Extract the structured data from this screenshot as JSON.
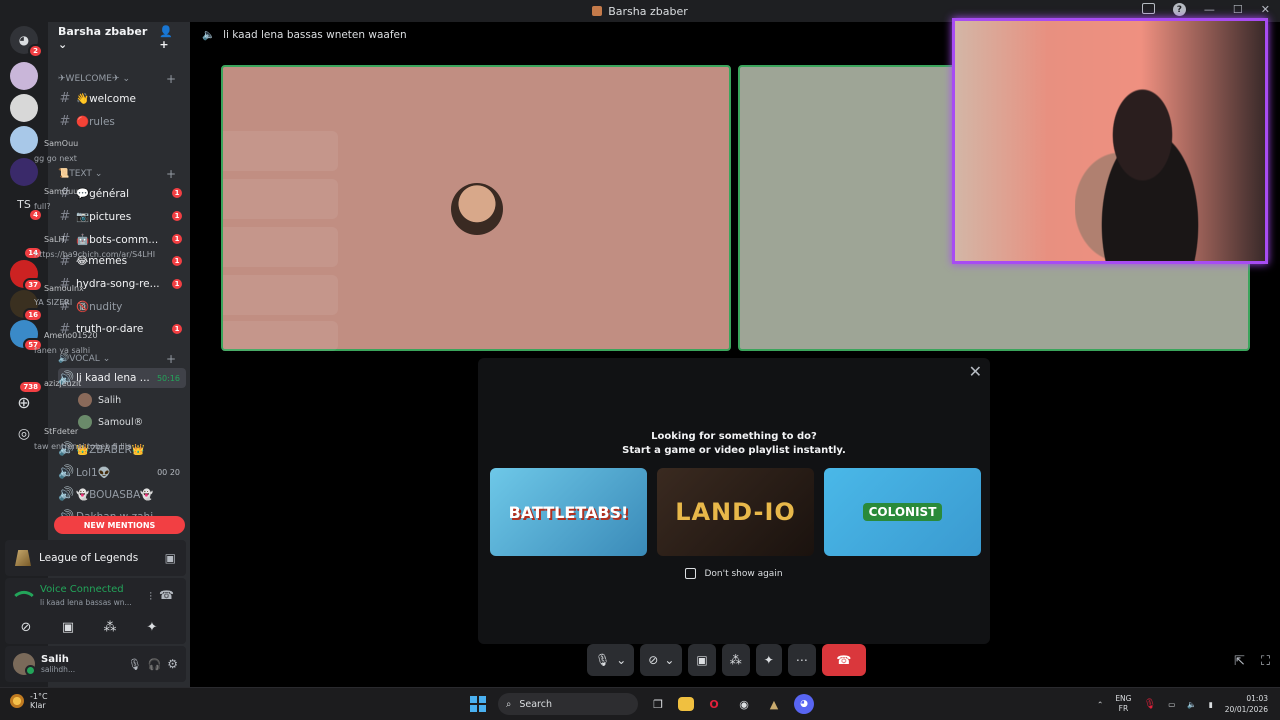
{
  "window": {
    "title": "Barsha zbaber"
  },
  "rail": {
    "home_badge": "2",
    "servers": [
      {
        "label": "",
        "badge": ""
      },
      {
        "label": "",
        "badge": ""
      },
      {
        "label": "",
        "badge": ""
      },
      {
        "label": "",
        "badge": ""
      },
      {
        "label": "TS",
        "badge": "4"
      },
      {
        "label": "",
        "badge": "14"
      },
      {
        "label": "",
        "badge": "37"
      },
      {
        "label": "",
        "badge": "16"
      },
      {
        "label": "",
        "badge": "57"
      },
      {
        "label": "",
        "badge": "738"
      }
    ]
  },
  "sidebar": {
    "server_name": "Barsha zbaber",
    "categories": {
      "welcome": "✈WELCOME✈",
      "text": "📜TEXT",
      "vocal": "🔊VOCAL"
    },
    "channels": [
      {
        "name": "👋welcome",
        "badge": ""
      },
      {
        "name": "🔴rules",
        "badge": ""
      },
      {
        "name": "💬général",
        "badge": "1"
      },
      {
        "name": "📷pictures",
        "badge": "1"
      },
      {
        "name": "🤖bots-comm...",
        "badge": "1"
      },
      {
        "name": "😂memes",
        "badge": "1"
      },
      {
        "name": "hydra-song-re...",
        "badge": "1"
      },
      {
        "name": "🔞nudity",
        "badge": ""
      },
      {
        "name": "truth-or-dare",
        "badge": "1"
      }
    ],
    "voice_channels": [
      {
        "name": "li kaad lena ...",
        "timer": "50:16"
      },
      {
        "name": "👑ZBABER👑",
        "timer": ""
      },
      {
        "name": "Lol1👽",
        "timer": "00 20"
      },
      {
        "name": "👻BOUASBA👻",
        "timer": ""
      },
      {
        "name": "Dakhan w zahi",
        "timer": ""
      }
    ],
    "voice_users": [
      "Salih",
      "Samoul®"
    ],
    "new_mentions": "NEW MENTIONS"
  },
  "overlay_chat": [
    {
      "name": "SamOuu",
      "msg": "gg go next"
    },
    {
      "name": "SamOuu",
      "msg": "full?"
    },
    {
      "name": "SaLH",
      "msg": "https://ba9chich.com/ar/S4LHI"
    },
    {
      "name": "Samoulnx",
      "msg": "YA SIZERI"
    },
    {
      "name": "Ameno01520",
      "msg": "fanen ya salhi"
    },
    {
      "name": "azizjeuzit",
      "msg": ""
    },
    {
      "name": "StFdeter",
      "msg": "taw entrenei tobeb fi lila"
    }
  ],
  "activity": {
    "game": "League of Legends"
  },
  "voice": {
    "status": "Voice Connected",
    "channel": "li kaad lena bassas wn..."
  },
  "user": {
    "name": "Salih",
    "sub": "salihdh..."
  },
  "call": {
    "header": "li kaad lena bassas wneten waafen",
    "prompt_line1": "Looking for something to do?",
    "prompt_line2": "Start a game or video playlist instantly.",
    "games": [
      "BATTLETABS!",
      "LAND-IO",
      "COLONIST"
    ],
    "dont_show": "Don't show again"
  },
  "taskbar": {
    "weather_temp": "-1°C",
    "weather_desc": "Klar",
    "search": "Search",
    "lang1": "ENG",
    "lang2": "FR",
    "time": "01:03",
    "date": "20/01/2026"
  }
}
